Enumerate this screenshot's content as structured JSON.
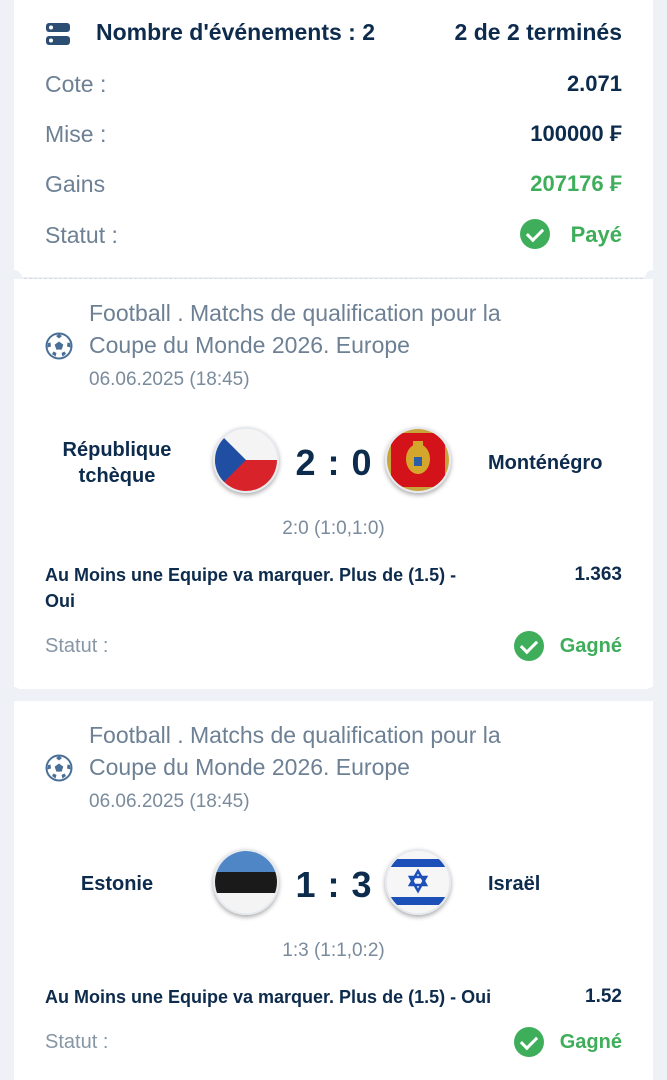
{
  "summary": {
    "events_label": "Nombre d'événements : 2",
    "finished_label": "2 de 2 terminés",
    "odds_label": "Cote :",
    "odds_value": "2.071",
    "stake_label": "Mise :",
    "stake_value": "100000 ₣",
    "winnings_label": "Gains",
    "winnings_value": "207176 ₣",
    "status_label": "Statut :",
    "status_value": "Payé"
  },
  "events": [
    {
      "championship_line1": "Football . Matchs de qualification pour la",
      "championship_line2": "Coupe du Monde 2026. Europe",
      "date": "06.06.2025 (18:45)",
      "home_line1": "République",
      "home_line2": "tchèque",
      "away": "Monténégro",
      "score": "2 : 0",
      "score_detail": "2:0 (1:0,1:0)",
      "market_line1": "Au Moins une Equipe va marquer. Plus de (1.5) -",
      "market_line2": "Oui",
      "coef": "1.363",
      "status_label": "Statut :",
      "status_value": "Gagné"
    },
    {
      "championship_line1": "Football . Matchs de qualification pour la",
      "championship_line2": "Coupe du Monde 2026. Europe",
      "date": "06.06.2025 (18:45)",
      "home": "Estonie",
      "away": "Israël",
      "score": "1 : 3",
      "score_detail": "1:3 (1:1,0:2)",
      "market": "Au Moins une Equipe va marquer. Plus de (1.5) - Oui",
      "coef": "1.52",
      "status_label": "Statut :",
      "status_value": "Gagné"
    }
  ],
  "colors": {
    "text_dark": "#0d2b4c",
    "text_muted": "#6d8094",
    "success": "#3fae5b"
  }
}
